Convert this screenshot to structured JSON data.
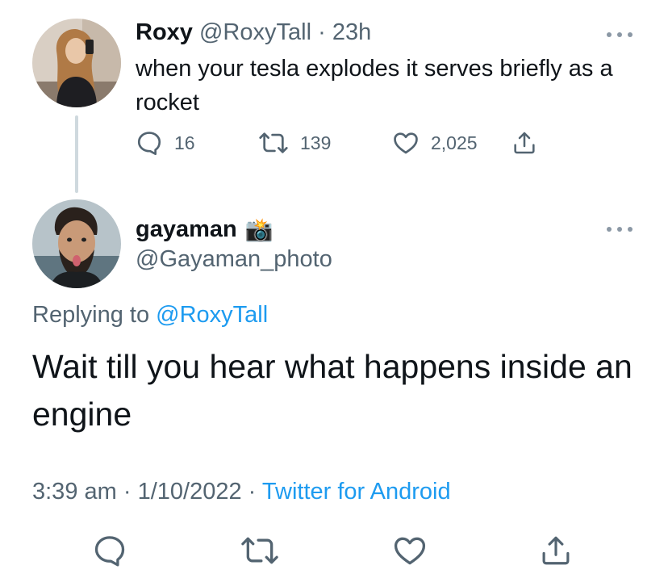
{
  "parent_tweet": {
    "name": "Roxy",
    "handle": "@RoxyTall",
    "separator": "·",
    "time": "23h",
    "text": "when your tesla explodes it serves briefly as a rocket",
    "stats": {
      "replies": "16",
      "retweets": "139",
      "likes": "2,025"
    }
  },
  "reply_tweet": {
    "name": "gayaman",
    "name_emoji": "📸",
    "handle": "@Gayaman_photo",
    "replying_prefix": "Replying to",
    "replying_to": "@RoxyTall",
    "text": "Wait till you hear what happens inside an engine",
    "time": "3:39 am",
    "separator": "·",
    "date": "1/10/2022",
    "source": "Twitter for Android"
  },
  "colors": {
    "text": "#0f1419",
    "secondary": "#536471",
    "link": "#1d9bf0",
    "thread_line": "#cfd9de"
  },
  "icons": [
    "reply-icon",
    "retweet-icon",
    "like-icon",
    "share-icon",
    "more-icon"
  ]
}
